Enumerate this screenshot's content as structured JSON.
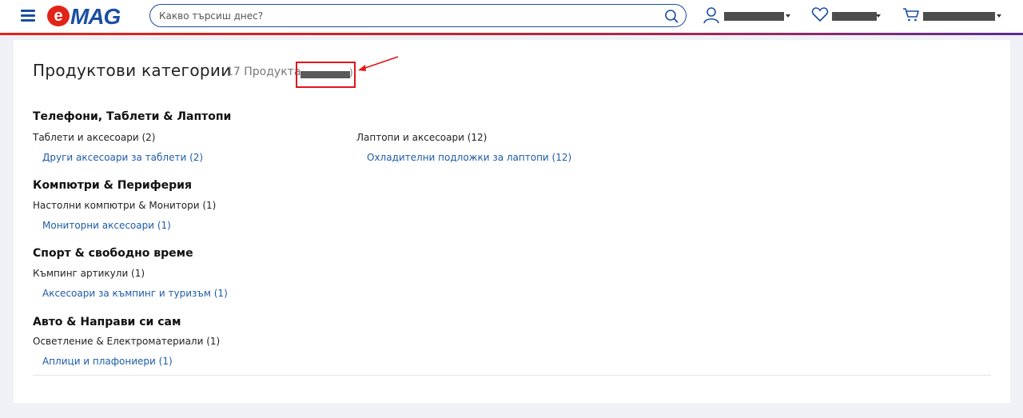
{
  "header": {
    "menu_icon": "hamburger-menu-icon",
    "logo_text": "eMAG",
    "colors": {
      "brand_red": "#e2231a",
      "brand_blue": "#1a4fa3",
      "link": "#1d5ba8"
    },
    "search": {
      "placeholder": "Какво търсиш днес?",
      "value": ""
    },
    "account_icon": "user-icon",
    "favorites_icon": "heart-icon",
    "cart_icon": "shopping-cart-icon"
  },
  "main": {
    "title": "Продуктови категории",
    "product_count": "17 Продукта",
    "count_close_paren": ")",
    "groups": [
      {
        "title": "Телефони, Таблети & Лаптопи",
        "columns": [
          {
            "category": "Таблети и аксесоари (2)",
            "subcategory": "Други аксесоари за таблети (2)"
          },
          {
            "category": "Лаптопи и аксесоари (12)",
            "subcategory": "Охладителни подложки за лаптопи (12)"
          }
        ]
      },
      {
        "title": "Компютри & Периферия",
        "columns": [
          {
            "category": "Настолни компютри & Монитори (1)",
            "subcategory": "Мониторни аксесоари (1)"
          }
        ]
      },
      {
        "title": "Спорт & свободно време",
        "columns": [
          {
            "category": "Къмпинг артикули (1)",
            "subcategory": "Аксесоари за къмпинг и туризъм (1)"
          }
        ]
      },
      {
        "title": "Авто & Направи си сам",
        "columns": [
          {
            "category": "Осветление & Електроматериали (1)",
            "subcategory": "Аплици и плафониери (1)"
          }
        ]
      }
    ]
  }
}
